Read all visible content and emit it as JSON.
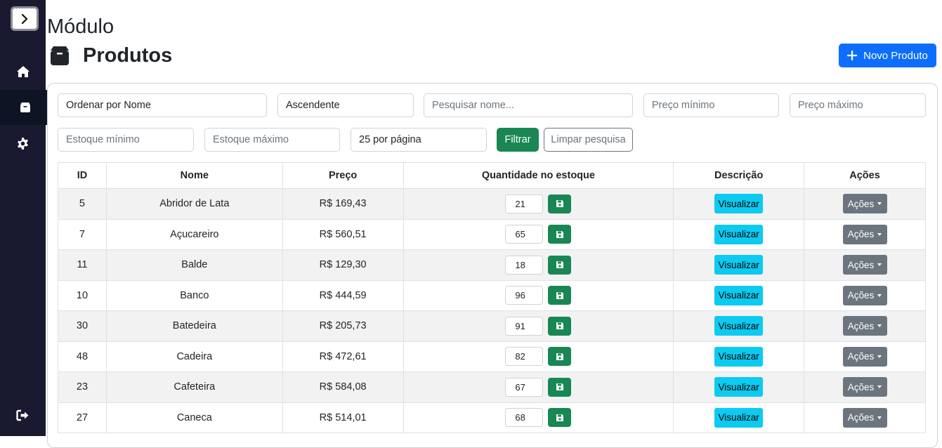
{
  "page": {
    "module_label": "Módulo",
    "title": "Produtos",
    "new_button_label": "Novo Produto"
  },
  "sidebar": {
    "items": [
      {
        "name": "home",
        "icon": "home-icon"
      },
      {
        "name": "produtos",
        "icon": "box-icon",
        "active": true
      },
      {
        "name": "settings",
        "icon": "gear-icon"
      },
      {
        "name": "logout",
        "icon": "sign-out-icon"
      }
    ]
  },
  "filters": {
    "order_by": "Ordenar por Nome",
    "direction": "Ascendente",
    "search_placeholder": "Pesquisar nome...",
    "price_min_placeholder": "Preço mínimo",
    "price_max_placeholder": "Preço máximo",
    "stock_min_placeholder": "Estoque mínimo",
    "stock_max_placeholder": "Estoque máximo",
    "per_page": "25 por página",
    "filter_label": "Filtrar",
    "clear_label": "Limpar pesquisa"
  },
  "table": {
    "headers": [
      "ID",
      "Nome",
      "Preço",
      "Quantidade no estoque",
      "Descrição",
      "Ações"
    ],
    "view_label": "Visualizar",
    "actions_label": "Ações",
    "rows": [
      {
        "id": "5",
        "name": "Abridor de Lata",
        "price": "R$ 169,43",
        "qty": "21"
      },
      {
        "id": "7",
        "name": "Açucareiro",
        "price": "R$ 560,51",
        "qty": "65"
      },
      {
        "id": "11",
        "name": "Balde",
        "price": "R$ 129,30",
        "qty": "18"
      },
      {
        "id": "10",
        "name": "Banco",
        "price": "R$ 444,59",
        "qty": "96"
      },
      {
        "id": "30",
        "name": "Batedeira",
        "price": "R$ 205,73",
        "qty": "91"
      },
      {
        "id": "48",
        "name": "Cadeira",
        "price": "R$ 472,61",
        "qty": "82"
      },
      {
        "id": "23",
        "name": "Cafeteira",
        "price": "R$ 584,08",
        "qty": "67"
      },
      {
        "id": "27",
        "name": "Caneca",
        "price": "R$ 514,01",
        "qty": "68"
      }
    ]
  },
  "colors": {
    "sidebar_bg": "#19192f",
    "primary": "#0d6efd",
    "success": "#198754",
    "info": "#0dcaf0",
    "secondary": "#6c757d"
  }
}
